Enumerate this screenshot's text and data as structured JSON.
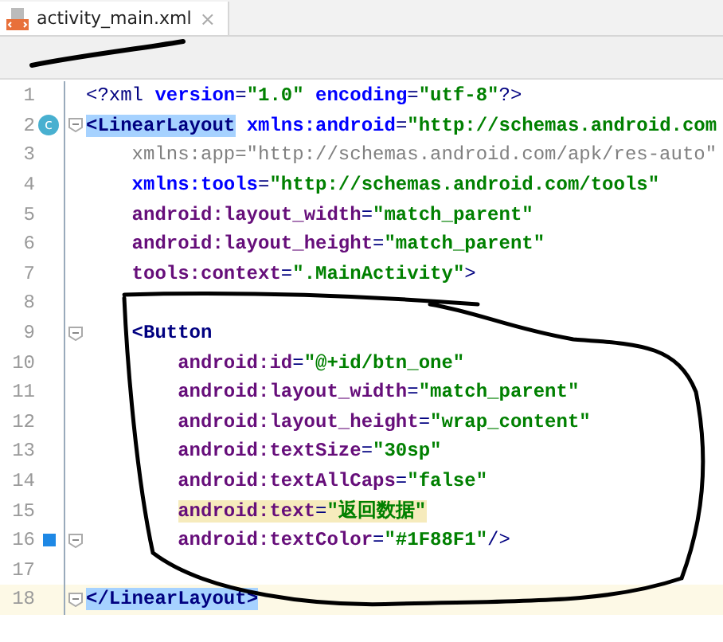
{
  "tab": {
    "title": "activity_main.xml",
    "close": "×"
  },
  "lines": [
    {
      "number": "1",
      "kind": "root",
      "current": false,
      "fold": false,
      "tokens": [
        {
          "kind": "punct",
          "text": "<?xml"
        },
        {
          "kind": "ns",
          "text": "version",
          "space_before": true
        },
        {
          "kind": "punct",
          "text": "="
        },
        {
          "kind": "value",
          "text": "\"1.0\""
        },
        {
          "kind": "ns",
          "text": "encoding",
          "space_before": true
        },
        {
          "kind": "punct",
          "text": "="
        },
        {
          "kind": "value",
          "text": "\"utf-8\""
        },
        {
          "kind": "punct",
          "text": "?>"
        }
      ]
    },
    {
      "number": "2",
      "kind": "root",
      "current": false,
      "fold": true,
      "badge": "c",
      "tokens": [
        {
          "kind": "tag",
          "text": "<LinearLayout",
          "selected": true
        },
        {
          "kind": "ns",
          "text": "xmlns:android",
          "space_before": true
        },
        {
          "kind": "punct",
          "text": "="
        },
        {
          "kind": "value",
          "text": "\"http://schemas.android.com"
        }
      ]
    },
    {
      "number": "3",
      "kind": "attribute",
      "current": false,
      "fold": false,
      "tokens": [
        {
          "kind": "unused",
          "text": "xmlns:app=\"http://schemas.android.com/apk/res-auto\""
        }
      ]
    },
    {
      "number": "4",
      "kind": "attribute",
      "current": false,
      "fold": false,
      "tokens": [
        {
          "kind": "ns",
          "text": "xmlns:tools"
        },
        {
          "kind": "punct",
          "text": "="
        },
        {
          "kind": "value",
          "text": "\"http://schemas.android.com/tools\""
        }
      ]
    },
    {
      "number": "5",
      "kind": "attribute",
      "current": false,
      "fold": false,
      "tokens": [
        {
          "kind": "attr",
          "text": "android:layout_width"
        },
        {
          "kind": "punct",
          "text": "="
        },
        {
          "kind": "value",
          "text": "\"match_parent\""
        }
      ]
    },
    {
      "number": "6",
      "kind": "attribute",
      "current": false,
      "fold": false,
      "tokens": [
        {
          "kind": "attr",
          "text": "android:layout_height"
        },
        {
          "kind": "punct",
          "text": "="
        },
        {
          "kind": "value",
          "text": "\"match_parent\""
        }
      ]
    },
    {
      "number": "7",
      "kind": "attribute",
      "current": false,
      "fold": false,
      "tokens": [
        {
          "kind": "attr",
          "text": "tools:context"
        },
        {
          "kind": "punct",
          "text": "="
        },
        {
          "kind": "value",
          "text": "\".MainActivity\""
        },
        {
          "kind": "punct",
          "text": ">"
        }
      ]
    },
    {
      "number": "8",
      "kind": "root",
      "current": false,
      "fold": false
    },
    {
      "number": "9",
      "kind": "child",
      "current": false,
      "fold": true,
      "tokens": [
        {
          "kind": "tag",
          "text": "<Button"
        }
      ]
    },
    {
      "number": "10",
      "kind": "child-attribute",
      "current": false,
      "fold": false,
      "tokens": [
        {
          "kind": "attr",
          "text": "android:id"
        },
        {
          "kind": "punct",
          "text": "="
        },
        {
          "kind": "value",
          "text": "\"@+id/btn_one\""
        }
      ]
    },
    {
      "number": "11",
      "kind": "child-attribute",
      "current": false,
      "fold": false,
      "tokens": [
        {
          "kind": "attr",
          "text": "android:layout_width"
        },
        {
          "kind": "punct",
          "text": "="
        },
        {
          "kind": "value",
          "text": "\"match_parent\""
        }
      ]
    },
    {
      "number": "12",
      "kind": "child-attribute",
      "current": false,
      "fold": false,
      "tokens": [
        {
          "kind": "attr",
          "text": "android:layout_height"
        },
        {
          "kind": "punct",
          "text": "="
        },
        {
          "kind": "value",
          "text": "\"wrap_content\""
        }
      ]
    },
    {
      "number": "13",
      "kind": "child-attribute",
      "current": false,
      "fold": false,
      "tokens": [
        {
          "kind": "attr",
          "text": "android:textSize"
        },
        {
          "kind": "punct",
          "text": "="
        },
        {
          "kind": "value",
          "text": "\"30sp\""
        }
      ]
    },
    {
      "number": "14",
      "kind": "child-attribute",
      "current": false,
      "fold": false,
      "tokens": [
        {
          "kind": "attr",
          "text": "android:textAllCaps"
        },
        {
          "kind": "punct",
          "text": "="
        },
        {
          "kind": "value",
          "text": "\"false\""
        }
      ]
    },
    {
      "number": "15",
      "kind": "child-attribute",
      "current": false,
      "fold": false,
      "warning": true,
      "tokens": [
        {
          "kind": "attr",
          "text": "android:text"
        },
        {
          "kind": "punct",
          "text": "="
        },
        {
          "kind": "value",
          "text": "\"返回数据\""
        }
      ]
    },
    {
      "number": "16",
      "kind": "child-attribute",
      "current": false,
      "fold": true,
      "bookmark": true,
      "tokens": [
        {
          "kind": "attr",
          "text": "android:textColor"
        },
        {
          "kind": "punct",
          "text": "="
        },
        {
          "kind": "value",
          "text": "\"#1F88F1\""
        },
        {
          "kind": "punct",
          "text": "/>"
        }
      ]
    },
    {
      "number": "17",
      "kind": "root",
      "current": false,
      "fold": false
    },
    {
      "number": "18",
      "kind": "root",
      "current": true,
      "fold": true,
      "tokens": [
        {
          "kind": "tag",
          "text": "</LinearLayout>",
          "selected": true
        }
      ]
    }
  ]
}
